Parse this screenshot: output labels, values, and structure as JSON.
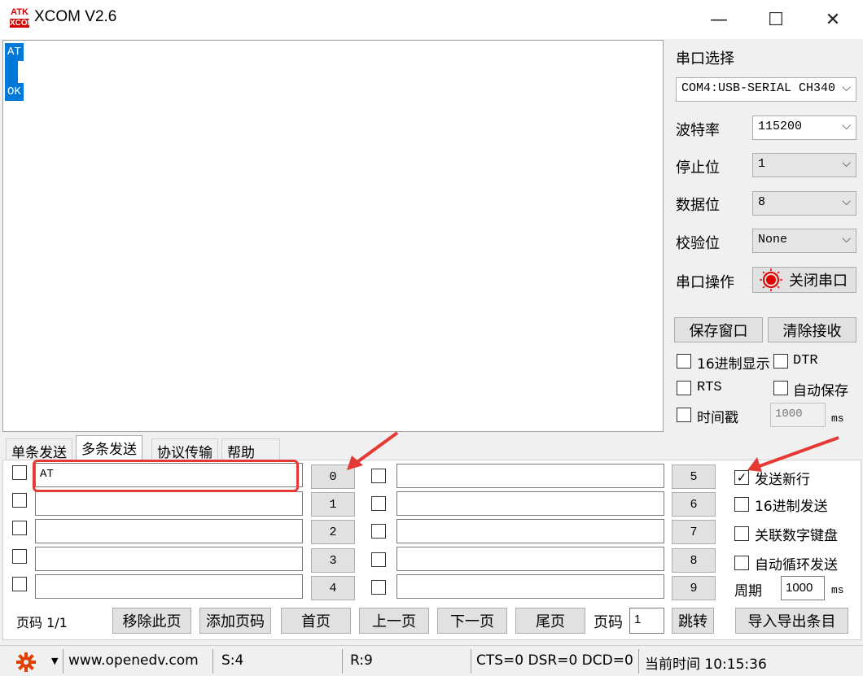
{
  "window": {
    "logo_top": "ATK",
    "logo_bottom": "XCOM",
    "title": "XCOM V2.6",
    "minimize": "—",
    "maximize": "☐",
    "close": "✕"
  },
  "receive": {
    "lines": [
      "AT",
      "",
      "OK"
    ]
  },
  "panel": {
    "port_select_label": "串口选择",
    "port_value": "COM4:USB-SERIAL CH340",
    "baud_label": "波特率",
    "baud_value": "115200",
    "stopbits_label": "停止位",
    "stopbits_value": "1",
    "databits_label": "数据位",
    "databits_value": "8",
    "parity_label": "校验位",
    "parity_value": "None",
    "port_op_label": "串口操作",
    "close_port_button": "关闭串口",
    "save_window_button": "保存窗口",
    "clear_receive_button": "清除接收",
    "hex_display": "16进制显示",
    "dtr": "DTR",
    "rts": "RTS",
    "auto_save": "自动保存",
    "timestamp": "时间戳",
    "timestamp_value": "1000",
    "timestamp_unit": "ms",
    "status_color": "#e00000"
  },
  "tabs": [
    "单条发送",
    "多条发送",
    "协议传输",
    "帮助"
  ],
  "multi_send": {
    "rows_left": [
      {
        "text": "AT",
        "btn": "0"
      },
      {
        "text": "",
        "btn": "1"
      },
      {
        "text": "",
        "btn": "2"
      },
      {
        "text": "",
        "btn": "3"
      },
      {
        "text": "",
        "btn": "4"
      }
    ],
    "rows_right": [
      {
        "text": "",
        "btn": "5"
      },
      {
        "text": "",
        "btn": "6"
      },
      {
        "text": "",
        "btn": "7"
      },
      {
        "text": "",
        "btn": "8"
      },
      {
        "text": "",
        "btn": "9"
      }
    ],
    "send_newline": "发送新行",
    "send_newline_checked": true,
    "hex_send": "16进制发送",
    "link_keypad": "关联数字键盘",
    "auto_loop": "自动循环发送",
    "period_label": "周期",
    "period_value": "1000",
    "period_unit": "ms",
    "page_label": "页码 1/1",
    "remove_page": "移除此页",
    "add_page": "添加页码",
    "first_page": "首页",
    "prev_page": "上一页",
    "next_page": "下一页",
    "last_page": "尾页",
    "goto_label": "页码",
    "goto_value": "1",
    "jump_button": "跳转",
    "import_export": "导入导出条目"
  },
  "status": {
    "url": "www.openedv.com",
    "sent": "S:4",
    "received": "R:9",
    "lines": "CTS=0 DSR=0 DCD=0",
    "time": "当前时间 10:15:36"
  },
  "annotation_color": "#e53935"
}
